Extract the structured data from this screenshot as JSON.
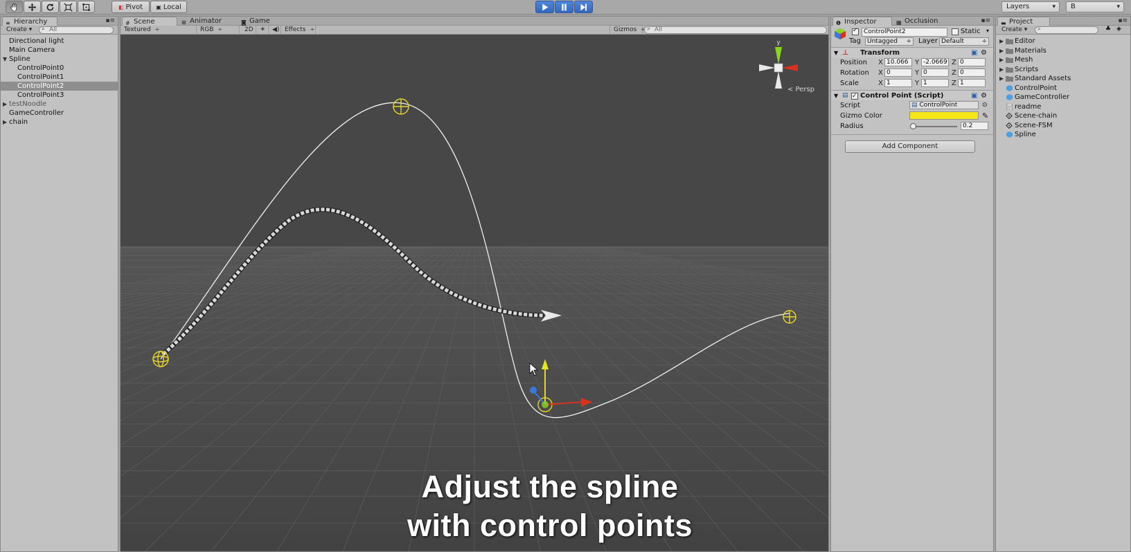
{
  "toolbar": {
    "tools": [
      "hand-tool",
      "move-tool",
      "rotate-tool",
      "scale-tool",
      "rect-tool"
    ],
    "pivot_label": "Pivot",
    "local_label": "Local",
    "layers_label": "Layers",
    "layout_label": "B"
  },
  "hierarchy": {
    "tab": "Hierarchy",
    "create_label": "Create",
    "search_placeholder": "All",
    "items": [
      {
        "label": "Directional light",
        "level": 0
      },
      {
        "label": "Main Camera",
        "level": 0
      },
      {
        "label": "Spline",
        "level": 0,
        "expanded": true
      },
      {
        "label": "ControlPoint0",
        "level": 1
      },
      {
        "label": "ControlPoint1",
        "level": 1
      },
      {
        "label": "ControlPoint2",
        "level": 1,
        "selected": true
      },
      {
        "label": "ControlPoint3",
        "level": 1
      },
      {
        "label": "testNoodle",
        "level": 0,
        "collapsed": true
      },
      {
        "label": "GameController",
        "level": 0
      },
      {
        "label": "chain",
        "level": 0,
        "collapsed": true
      }
    ]
  },
  "scene": {
    "tabs": [
      "Scene",
      "Animator",
      "Game"
    ],
    "shading": "Textured",
    "render_mode": "RGB",
    "toggle_2d": "2D",
    "effects_label": "Effects",
    "gizmos_label": "Gizmos",
    "search_placeholder": "All",
    "persp_label": "Persp",
    "gizmo_y": "y",
    "caption_line1": "Adjust the spline",
    "caption_line2": "with control points"
  },
  "inspector": {
    "tabs": [
      "Inspector",
      "Occlusion"
    ],
    "object_name": "ControlPoint2",
    "static_label": "Static",
    "tag_label": "Tag",
    "tag_value": "Untagged",
    "layer_label": "Layer",
    "layer_value": "Default",
    "transform": {
      "title": "Transform",
      "position_label": "Position",
      "rotation_label": "Rotation",
      "scale_label": "Scale",
      "position": {
        "x": "10.066",
        "y": "-2.0669",
        "z": "0"
      },
      "rotation": {
        "x": "0",
        "y": "0",
        "z": "0"
      },
      "scale": {
        "x": "1",
        "y": "1",
        "z": "1"
      }
    },
    "control_point": {
      "title": "Control Point (Script)",
      "script_label": "Script",
      "script_value": "ControlPoint",
      "gizmo_color_label": "Gizmo Color",
      "gizmo_color": "#f5e61a",
      "radius_label": "Radius",
      "radius_value": "0.2"
    },
    "add_component": "Add Component"
  },
  "project": {
    "tab": "Project",
    "create_label": "Create",
    "items": [
      {
        "label": "Editor",
        "type": "folder"
      },
      {
        "label": "Materials",
        "type": "folder"
      },
      {
        "label": "Mesh",
        "type": "folder"
      },
      {
        "label": "Scripts",
        "type": "folder"
      },
      {
        "label": "Standard Assets",
        "type": "folder"
      },
      {
        "label": "ControlPoint",
        "type": "prefab"
      },
      {
        "label": "GameController",
        "type": "prefab"
      },
      {
        "label": "readme",
        "type": "text"
      },
      {
        "label": "Scene-chain",
        "type": "scene"
      },
      {
        "label": "Scene-FSM",
        "type": "scene"
      },
      {
        "label": "Spline",
        "type": "prefab"
      }
    ]
  },
  "colors": {
    "scene_bg": "#474747",
    "selection": "#8e8e8e",
    "play_blue": "#3f74c9",
    "gizmo_yellow": "#e6d52a",
    "axis_red": "#d8321e",
    "axis_green": "#8ad61e",
    "axis_blue": "#3a78e0"
  }
}
